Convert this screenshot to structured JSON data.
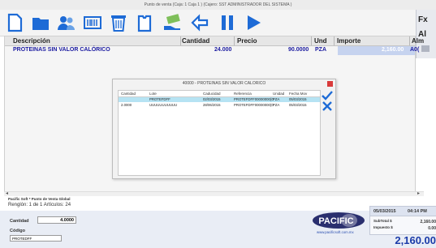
{
  "window": {
    "title": "Punto de venta  (Caja: 1  Caja 1 )   (Cajero: SST  ADMINISTRADOR DEL SISTEMA )"
  },
  "toolbar": {
    "buttons": [
      {
        "icon": "new-document-icon"
      },
      {
        "icon": "folder-icon"
      },
      {
        "icon": "users-icon"
      },
      {
        "icon": "barcode-icon"
      },
      {
        "icon": "trash-icon"
      },
      {
        "icon": "document-icon"
      },
      {
        "icon": "money-hand-icon"
      },
      {
        "icon": "back-arrow-icon"
      },
      {
        "icon": "pause-icon"
      },
      {
        "icon": "play-icon"
      }
    ]
  },
  "right_panel": {
    "items": [
      "Fx",
      "Al"
    ]
  },
  "grid": {
    "columns": [
      "Descripción",
      "Cantidad",
      "Precio",
      "Und",
      "Importe",
      "Alm"
    ],
    "rows": [
      {
        "descripcion": "PROTEINAS SIN VALOR CALÓRICO",
        "cantidad": "24.000",
        "precio": "90.0000",
        "und": "PZA",
        "importe": "2,160.00",
        "alm": "A0("
      }
    ]
  },
  "dialog": {
    "title": "40000 - PROTEINAS SIN VALOR CALORICO",
    "columns": [
      "Cantidad",
      "Lote",
      "Caducidad",
      "Referencia",
      "Unidad",
      "Fecha Mov"
    ],
    "rows": [
      {
        "cantidad": "",
        "lote": "PROTEFDFF",
        "caducidad": "02/03/2015",
        "referencia": "PROTEFDFF00000000(0",
        "unidad": "PZA",
        "fecha": "05/03/2015"
      },
      {
        "cantidad": "2.0000",
        "lote": "UUUUUUUUUUU",
        "caducidad": "28/06/2015",
        "referencia": "PROTEFDFF00000000(0",
        "unidad": "PZA",
        "fecha": "05/03/2015"
      }
    ]
  },
  "footer": {
    "company": "Pacific Soft * Punto de Venta Global",
    "status": "Renglón: 1 de 1   Artículos: 24",
    "cantidad_label": "Cantidad",
    "cantidad_value": "4.0000",
    "codigo_label": "Código",
    "codigo_value": "PROTEDFF",
    "logo_text": "PACIFIC",
    "website": "www.pacificsoft.com.mx",
    "date": "05/03/2015",
    "time": "04:14 PM",
    "subtotal_label": "SubTotal $",
    "subtotal_value": "2,160.00",
    "impuesto_label": "Impuesto $",
    "impuesto_value": "0.00",
    "total": "2,160.00"
  },
  "colors": {
    "accent_blue": "#1e6bd6",
    "row_text": "#1a1aa0",
    "selected_row": "#b6e3f3",
    "total_text": "#1a3aa8"
  }
}
